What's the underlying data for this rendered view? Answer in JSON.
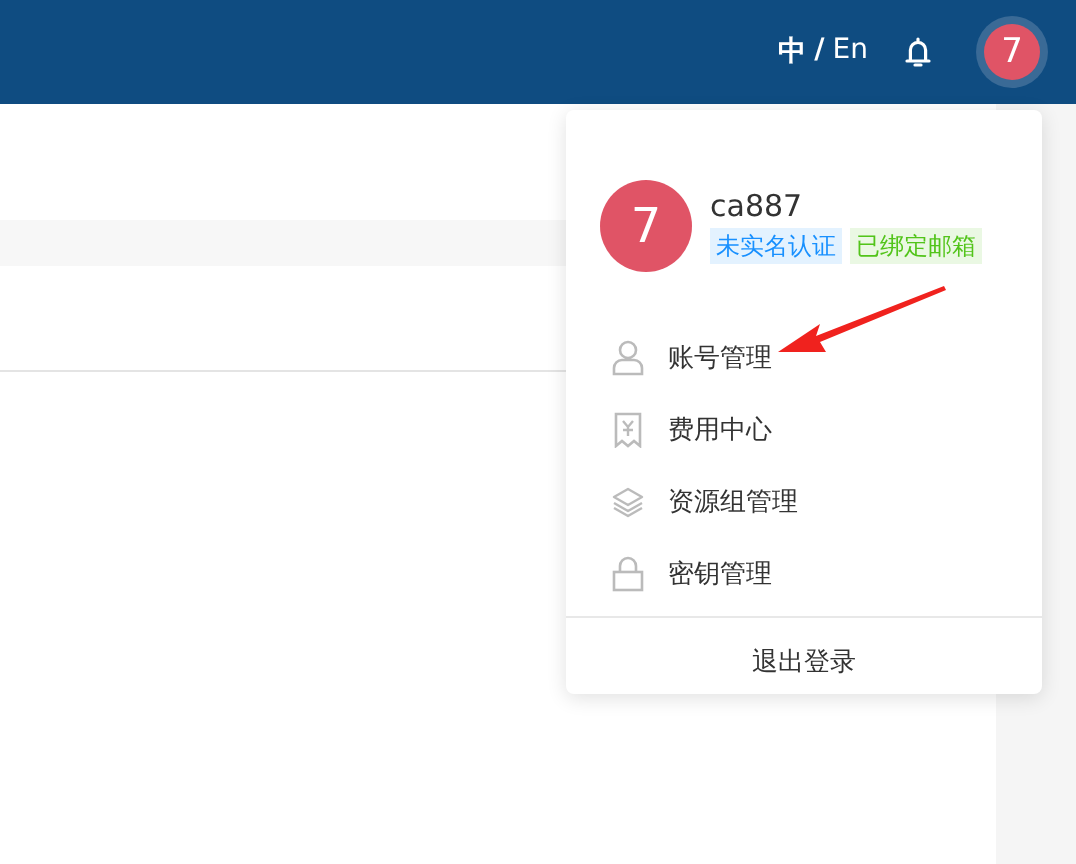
{
  "header": {
    "languages": [
      {
        "label": "中",
        "selected": true
      },
      {
        "label": "En",
        "selected": false
      }
    ],
    "language_separator": "/",
    "avatar_initial": "7"
  },
  "user_menu": {
    "avatar_initial": "7",
    "username": "ca887",
    "tags": [
      {
        "text": "未实名认证",
        "color": "#1890ff"
      },
      {
        "text": "已绑定邮箱",
        "color": "#52c41a"
      }
    ],
    "items": [
      {
        "label": "账号管理",
        "kind": "user"
      },
      {
        "label": "费用中心",
        "kind": "receipt"
      },
      {
        "label": "资源组管理",
        "kind": "layers"
      },
      {
        "label": "密钥管理",
        "kind": "lock"
      }
    ],
    "logout": "退出登录"
  }
}
